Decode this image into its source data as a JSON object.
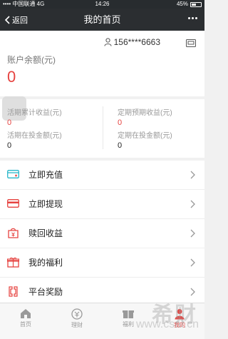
{
  "status_bar": {
    "carrier": "•••• 中国联通",
    "network": "4G",
    "time": "14:26",
    "battery": "45%"
  },
  "nav": {
    "back_label": "返回",
    "title": "我的首页"
  },
  "account": {
    "phone": "156****6663",
    "balance_label": "账户余额(元)",
    "balance_value": "0"
  },
  "stats": {
    "current_income_label": "活期累计收益(元)",
    "current_income_value": "0",
    "fixed_expected_label": "定期预期收益(元)",
    "fixed_expected_value": "0",
    "current_invest_label": "活期在投金额(元)",
    "current_invest_value": "0",
    "fixed_invest_label": "定期在投金额(元)",
    "fixed_invest_value": "0"
  },
  "menu_group1": [
    {
      "label": "立即充值",
      "icon": "recharge-card-icon"
    },
    {
      "label": "立即提现",
      "icon": "withdraw-card-icon"
    },
    {
      "label": "赎回收益",
      "icon": "redeem-bag-icon"
    }
  ],
  "menu_group2": [
    {
      "label": "我的福利",
      "icon": "gift-icon"
    },
    {
      "label": "平台奖励",
      "icon": "reward-icon"
    }
  ],
  "tabs": [
    {
      "label": "首页",
      "icon": "home-icon"
    },
    {
      "label": "理财",
      "icon": "finance-icon"
    },
    {
      "label": "福利",
      "icon": "gift-tab-icon"
    },
    {
      "label": "我的",
      "icon": "user-icon",
      "active": true
    }
  ],
  "watermark": {
    "text": "希财",
    "url": "www.csai.cn"
  },
  "colors": {
    "accent": "#e64340",
    "navbar": "#2b2e31"
  }
}
